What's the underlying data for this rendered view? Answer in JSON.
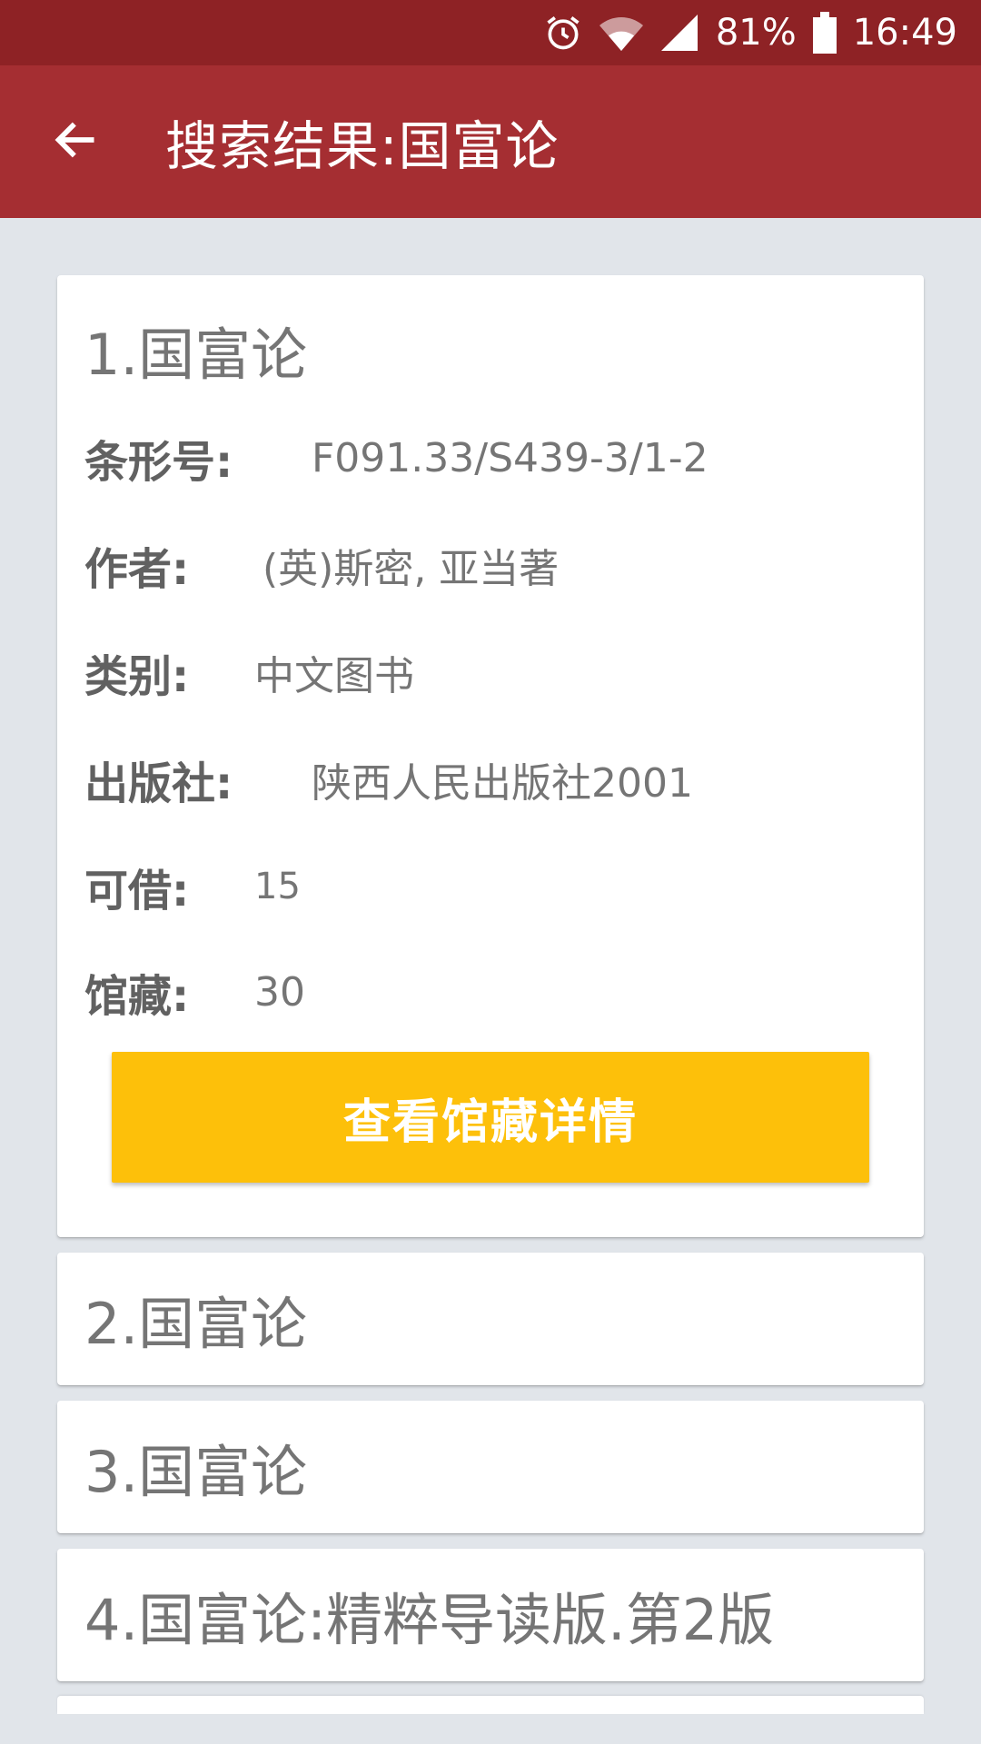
{
  "status_bar": {
    "battery": "81%",
    "time": "16:49"
  },
  "app_bar": {
    "title": "搜索结果:国富论"
  },
  "results": [
    {
      "title": "1.国富论",
      "fields": [
        {
          "label": "条形号:",
          "value": "F091.33/S439-3/1-2"
        },
        {
          "label": "作者:",
          "value": "(英)斯密, 亚当著"
        },
        {
          "label": "类别:",
          "value": "中文图书"
        },
        {
          "label": "出版社:",
          "value": "陕西人民出版社2001"
        },
        {
          "label": "可借:",
          "value": "15"
        },
        {
          "label": "馆藏:",
          "value": "30"
        }
      ],
      "button_label": "查看馆藏详情"
    },
    {
      "title": "2.国富论"
    },
    {
      "title": "3.国富论"
    },
    {
      "title": "4.国富论:精粹导读版.第2版"
    }
  ],
  "colors": {
    "status_bar": "#8e2225",
    "app_bar": "#a52e32",
    "background": "#e1e5ea",
    "button": "#fdc00a"
  }
}
